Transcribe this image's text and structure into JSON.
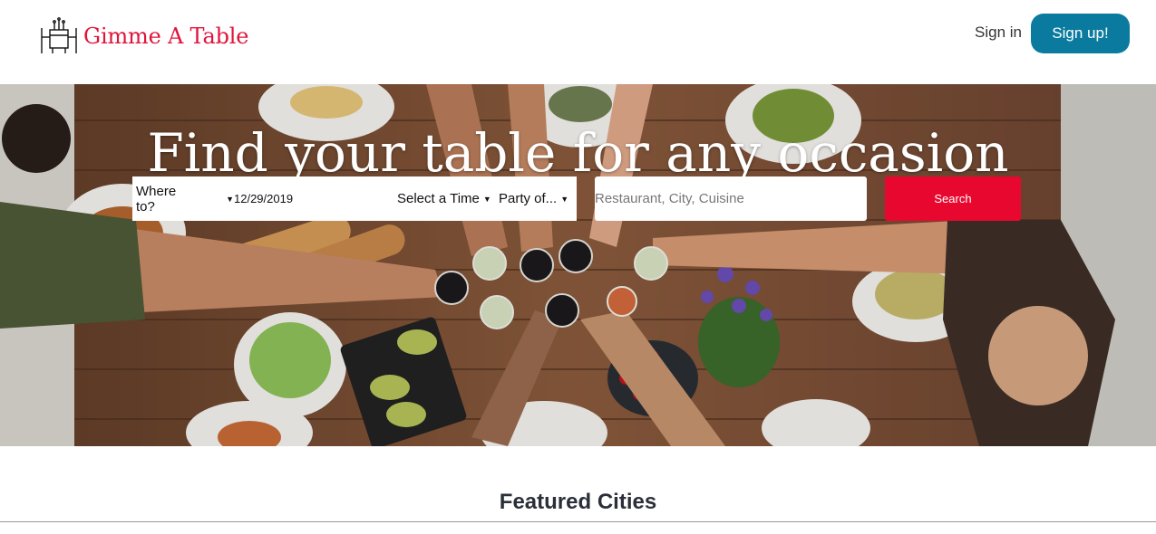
{
  "brand": {
    "name": "Gimme A Table",
    "accent": "#e0143c"
  },
  "nav": {
    "signin": "Sign in",
    "signup": "Sign up!",
    "signup_color": "#0a7b9e"
  },
  "hero": {
    "title": "Find your table for any occasion",
    "where": "Where to?",
    "date": "12/29/2019",
    "time": "Select a Time",
    "party": "Party of...",
    "search_placeholder": "Restaurant, City, Cuisine",
    "search_button": "Search",
    "search_color": "#e8082f"
  },
  "featured": {
    "title": "Featured Cities"
  }
}
